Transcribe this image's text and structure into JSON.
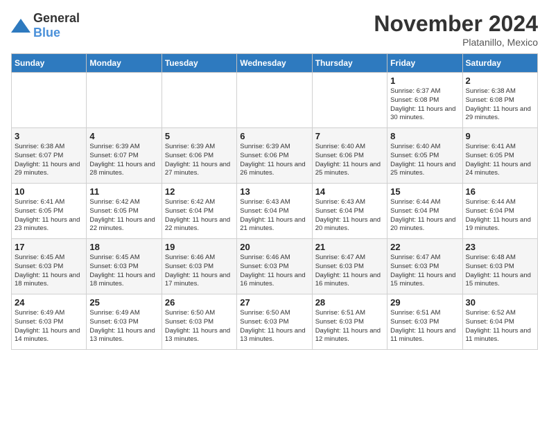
{
  "logo": {
    "general": "General",
    "blue": "Blue"
  },
  "title": "November 2024",
  "location": "Platanillo, Mexico",
  "days_of_week": [
    "Sunday",
    "Monday",
    "Tuesday",
    "Wednesday",
    "Thursday",
    "Friday",
    "Saturday"
  ],
  "weeks": [
    [
      {
        "day": "",
        "info": ""
      },
      {
        "day": "",
        "info": ""
      },
      {
        "day": "",
        "info": ""
      },
      {
        "day": "",
        "info": ""
      },
      {
        "day": "",
        "info": ""
      },
      {
        "day": "1",
        "info": "Sunrise: 6:37 AM\nSunset: 6:08 PM\nDaylight: 11 hours and 30 minutes."
      },
      {
        "day": "2",
        "info": "Sunrise: 6:38 AM\nSunset: 6:08 PM\nDaylight: 11 hours and 29 minutes."
      }
    ],
    [
      {
        "day": "3",
        "info": "Sunrise: 6:38 AM\nSunset: 6:07 PM\nDaylight: 11 hours and 29 minutes."
      },
      {
        "day": "4",
        "info": "Sunrise: 6:39 AM\nSunset: 6:07 PM\nDaylight: 11 hours and 28 minutes."
      },
      {
        "day": "5",
        "info": "Sunrise: 6:39 AM\nSunset: 6:06 PM\nDaylight: 11 hours and 27 minutes."
      },
      {
        "day": "6",
        "info": "Sunrise: 6:39 AM\nSunset: 6:06 PM\nDaylight: 11 hours and 26 minutes."
      },
      {
        "day": "7",
        "info": "Sunrise: 6:40 AM\nSunset: 6:06 PM\nDaylight: 11 hours and 25 minutes."
      },
      {
        "day": "8",
        "info": "Sunrise: 6:40 AM\nSunset: 6:05 PM\nDaylight: 11 hours and 25 minutes."
      },
      {
        "day": "9",
        "info": "Sunrise: 6:41 AM\nSunset: 6:05 PM\nDaylight: 11 hours and 24 minutes."
      }
    ],
    [
      {
        "day": "10",
        "info": "Sunrise: 6:41 AM\nSunset: 6:05 PM\nDaylight: 11 hours and 23 minutes."
      },
      {
        "day": "11",
        "info": "Sunrise: 6:42 AM\nSunset: 6:05 PM\nDaylight: 11 hours and 22 minutes."
      },
      {
        "day": "12",
        "info": "Sunrise: 6:42 AM\nSunset: 6:04 PM\nDaylight: 11 hours and 22 minutes."
      },
      {
        "day": "13",
        "info": "Sunrise: 6:43 AM\nSunset: 6:04 PM\nDaylight: 11 hours and 21 minutes."
      },
      {
        "day": "14",
        "info": "Sunrise: 6:43 AM\nSunset: 6:04 PM\nDaylight: 11 hours and 20 minutes."
      },
      {
        "day": "15",
        "info": "Sunrise: 6:44 AM\nSunset: 6:04 PM\nDaylight: 11 hours and 20 minutes."
      },
      {
        "day": "16",
        "info": "Sunrise: 6:44 AM\nSunset: 6:04 PM\nDaylight: 11 hours and 19 minutes."
      }
    ],
    [
      {
        "day": "17",
        "info": "Sunrise: 6:45 AM\nSunset: 6:03 PM\nDaylight: 11 hours and 18 minutes."
      },
      {
        "day": "18",
        "info": "Sunrise: 6:45 AM\nSunset: 6:03 PM\nDaylight: 11 hours and 18 minutes."
      },
      {
        "day": "19",
        "info": "Sunrise: 6:46 AM\nSunset: 6:03 PM\nDaylight: 11 hours and 17 minutes."
      },
      {
        "day": "20",
        "info": "Sunrise: 6:46 AM\nSunset: 6:03 PM\nDaylight: 11 hours and 16 minutes."
      },
      {
        "day": "21",
        "info": "Sunrise: 6:47 AM\nSunset: 6:03 PM\nDaylight: 11 hours and 16 minutes."
      },
      {
        "day": "22",
        "info": "Sunrise: 6:47 AM\nSunset: 6:03 PM\nDaylight: 11 hours and 15 minutes."
      },
      {
        "day": "23",
        "info": "Sunrise: 6:48 AM\nSunset: 6:03 PM\nDaylight: 11 hours and 15 minutes."
      }
    ],
    [
      {
        "day": "24",
        "info": "Sunrise: 6:49 AM\nSunset: 6:03 PM\nDaylight: 11 hours and 14 minutes."
      },
      {
        "day": "25",
        "info": "Sunrise: 6:49 AM\nSunset: 6:03 PM\nDaylight: 11 hours and 13 minutes."
      },
      {
        "day": "26",
        "info": "Sunrise: 6:50 AM\nSunset: 6:03 PM\nDaylight: 11 hours and 13 minutes."
      },
      {
        "day": "27",
        "info": "Sunrise: 6:50 AM\nSunset: 6:03 PM\nDaylight: 11 hours and 13 minutes."
      },
      {
        "day": "28",
        "info": "Sunrise: 6:51 AM\nSunset: 6:03 PM\nDaylight: 11 hours and 12 minutes."
      },
      {
        "day": "29",
        "info": "Sunrise: 6:51 AM\nSunset: 6:03 PM\nDaylight: 11 hours and 11 minutes."
      },
      {
        "day": "30",
        "info": "Sunrise: 6:52 AM\nSunset: 6:04 PM\nDaylight: 11 hours and 11 minutes."
      }
    ]
  ]
}
